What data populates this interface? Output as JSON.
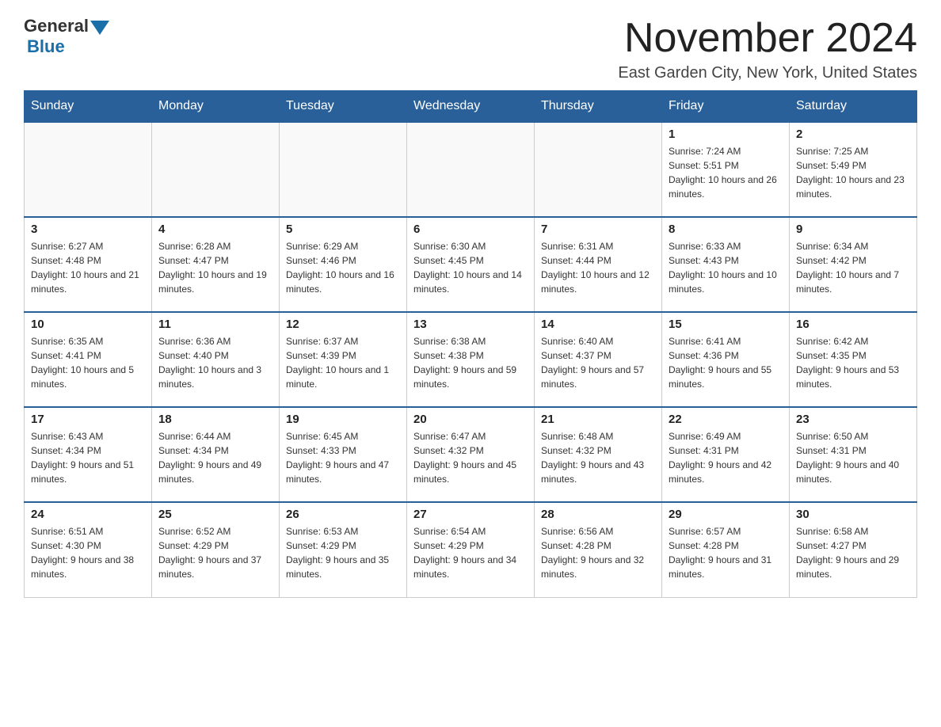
{
  "logo": {
    "general": "General",
    "blue": "Blue"
  },
  "title": "November 2024",
  "subtitle": "East Garden City, New York, United States",
  "days_of_week": [
    "Sunday",
    "Monday",
    "Tuesday",
    "Wednesday",
    "Thursday",
    "Friday",
    "Saturday"
  ],
  "weeks": [
    [
      {
        "day": "",
        "info": ""
      },
      {
        "day": "",
        "info": ""
      },
      {
        "day": "",
        "info": ""
      },
      {
        "day": "",
        "info": ""
      },
      {
        "day": "",
        "info": ""
      },
      {
        "day": "1",
        "info": "Sunrise: 7:24 AM\nSunset: 5:51 PM\nDaylight: 10 hours and 26 minutes."
      },
      {
        "day": "2",
        "info": "Sunrise: 7:25 AM\nSunset: 5:49 PM\nDaylight: 10 hours and 23 minutes."
      }
    ],
    [
      {
        "day": "3",
        "info": "Sunrise: 6:27 AM\nSunset: 4:48 PM\nDaylight: 10 hours and 21 minutes."
      },
      {
        "day": "4",
        "info": "Sunrise: 6:28 AM\nSunset: 4:47 PM\nDaylight: 10 hours and 19 minutes."
      },
      {
        "day": "5",
        "info": "Sunrise: 6:29 AM\nSunset: 4:46 PM\nDaylight: 10 hours and 16 minutes."
      },
      {
        "day": "6",
        "info": "Sunrise: 6:30 AM\nSunset: 4:45 PM\nDaylight: 10 hours and 14 minutes."
      },
      {
        "day": "7",
        "info": "Sunrise: 6:31 AM\nSunset: 4:44 PM\nDaylight: 10 hours and 12 minutes."
      },
      {
        "day": "8",
        "info": "Sunrise: 6:33 AM\nSunset: 4:43 PM\nDaylight: 10 hours and 10 minutes."
      },
      {
        "day": "9",
        "info": "Sunrise: 6:34 AM\nSunset: 4:42 PM\nDaylight: 10 hours and 7 minutes."
      }
    ],
    [
      {
        "day": "10",
        "info": "Sunrise: 6:35 AM\nSunset: 4:41 PM\nDaylight: 10 hours and 5 minutes."
      },
      {
        "day": "11",
        "info": "Sunrise: 6:36 AM\nSunset: 4:40 PM\nDaylight: 10 hours and 3 minutes."
      },
      {
        "day": "12",
        "info": "Sunrise: 6:37 AM\nSunset: 4:39 PM\nDaylight: 10 hours and 1 minute."
      },
      {
        "day": "13",
        "info": "Sunrise: 6:38 AM\nSunset: 4:38 PM\nDaylight: 9 hours and 59 minutes."
      },
      {
        "day": "14",
        "info": "Sunrise: 6:40 AM\nSunset: 4:37 PM\nDaylight: 9 hours and 57 minutes."
      },
      {
        "day": "15",
        "info": "Sunrise: 6:41 AM\nSunset: 4:36 PM\nDaylight: 9 hours and 55 minutes."
      },
      {
        "day": "16",
        "info": "Sunrise: 6:42 AM\nSunset: 4:35 PM\nDaylight: 9 hours and 53 minutes."
      }
    ],
    [
      {
        "day": "17",
        "info": "Sunrise: 6:43 AM\nSunset: 4:34 PM\nDaylight: 9 hours and 51 minutes."
      },
      {
        "day": "18",
        "info": "Sunrise: 6:44 AM\nSunset: 4:34 PM\nDaylight: 9 hours and 49 minutes."
      },
      {
        "day": "19",
        "info": "Sunrise: 6:45 AM\nSunset: 4:33 PM\nDaylight: 9 hours and 47 minutes."
      },
      {
        "day": "20",
        "info": "Sunrise: 6:47 AM\nSunset: 4:32 PM\nDaylight: 9 hours and 45 minutes."
      },
      {
        "day": "21",
        "info": "Sunrise: 6:48 AM\nSunset: 4:32 PM\nDaylight: 9 hours and 43 minutes."
      },
      {
        "day": "22",
        "info": "Sunrise: 6:49 AM\nSunset: 4:31 PM\nDaylight: 9 hours and 42 minutes."
      },
      {
        "day": "23",
        "info": "Sunrise: 6:50 AM\nSunset: 4:31 PM\nDaylight: 9 hours and 40 minutes."
      }
    ],
    [
      {
        "day": "24",
        "info": "Sunrise: 6:51 AM\nSunset: 4:30 PM\nDaylight: 9 hours and 38 minutes."
      },
      {
        "day": "25",
        "info": "Sunrise: 6:52 AM\nSunset: 4:29 PM\nDaylight: 9 hours and 37 minutes."
      },
      {
        "day": "26",
        "info": "Sunrise: 6:53 AM\nSunset: 4:29 PM\nDaylight: 9 hours and 35 minutes."
      },
      {
        "day": "27",
        "info": "Sunrise: 6:54 AM\nSunset: 4:29 PM\nDaylight: 9 hours and 34 minutes."
      },
      {
        "day": "28",
        "info": "Sunrise: 6:56 AM\nSunset: 4:28 PM\nDaylight: 9 hours and 32 minutes."
      },
      {
        "day": "29",
        "info": "Sunrise: 6:57 AM\nSunset: 4:28 PM\nDaylight: 9 hours and 31 minutes."
      },
      {
        "day": "30",
        "info": "Sunrise: 6:58 AM\nSunset: 4:27 PM\nDaylight: 9 hours and 29 minutes."
      }
    ]
  ]
}
